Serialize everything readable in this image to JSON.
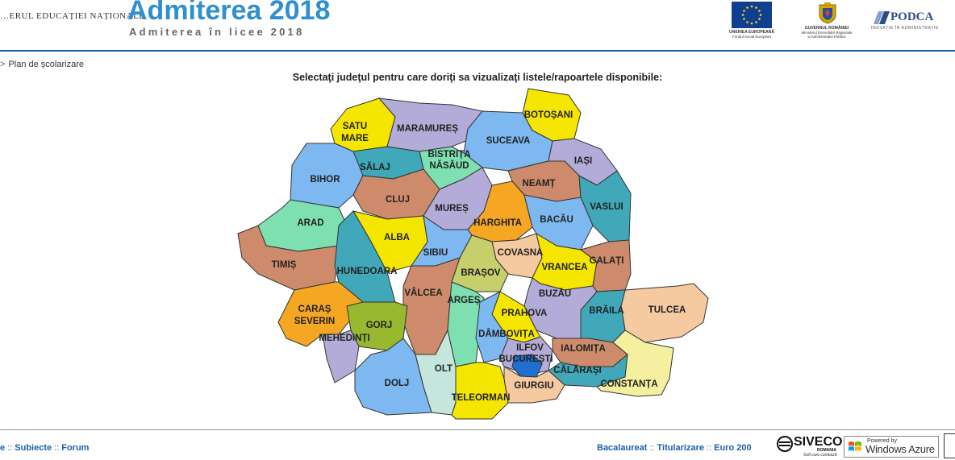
{
  "header": {
    "ministry": "…ERUL EDUCAȚIEI NAȚIONALE",
    "title": "Admiterea 2018",
    "subtitle": "Admiterea în licee 2018",
    "logos": {
      "eu_line1": "UNIUNEA EUROPEANĂ",
      "eu_line2": "Fondul Social European",
      "gov_line1": "GUVERNUL ROMÂNIEI",
      "gov_line2": "Ministerul Dezvoltării Regionale",
      "gov_line3": "și Administrației Publice",
      "podca_name": "PODCA",
      "podca_tag": "INOVAȚIE ÎN ADMINISTRAȚIE"
    },
    "colors": {
      "title": "#2f8fd0",
      "rule": "#1d5fa8"
    }
  },
  "breadcrumb": {
    "item": "Plan de școlarizare"
  },
  "instructions": "Selectaţi judeţul pentru care doriţi sa vizualizaţi listele/rapoartele disponibile:",
  "map": {
    "counties": [
      {
        "id": "satu-mare",
        "label": "SATU MARE",
        "color": "#f5e600"
      },
      {
        "id": "maramures",
        "label": "MARAMUREȘ",
        "color": "#b3acd8"
      },
      {
        "id": "botosani",
        "label": "BOTOȘANI",
        "color": "#f5e600"
      },
      {
        "id": "suceava",
        "label": "SUCEAVA",
        "color": "#7db8f0"
      },
      {
        "id": "bistrita-nasaud",
        "label": "BISTRIȚA NĂSĂUD",
        "color": "#7ee0b0"
      },
      {
        "id": "salaj",
        "label": "SĂLAJ",
        "color": "#40a8b8"
      },
      {
        "id": "bihor",
        "label": "BIHOR",
        "color": "#7db8f0"
      },
      {
        "id": "iasi",
        "label": "IAȘI",
        "color": "#b3acd8"
      },
      {
        "id": "neamt",
        "label": "NEAMȚ",
        "color": "#cd8b6b"
      },
      {
        "id": "cluj",
        "label": "CLUJ",
        "color": "#cd8b6b"
      },
      {
        "id": "mures",
        "label": "MUREȘ",
        "color": "#b3acd8"
      },
      {
        "id": "vaslui",
        "label": "VASLUI",
        "color": "#40a8b8"
      },
      {
        "id": "harghita",
        "label": "HARGHITA",
        "color": "#f5a623"
      },
      {
        "id": "bacau",
        "label": "BACĂU",
        "color": "#7db8f0"
      },
      {
        "id": "arad",
        "label": "ARAD",
        "color": "#7ee0b0"
      },
      {
        "id": "alba",
        "label": "ALBA",
        "color": "#f5e600"
      },
      {
        "id": "sibiu",
        "label": "SIBIU",
        "color": "#7db8f0"
      },
      {
        "id": "covasna",
        "label": "COVASNA",
        "color": "#f5caa0"
      },
      {
        "id": "vrancea",
        "label": "VRANCEA",
        "color": "#f5e600"
      },
      {
        "id": "galati",
        "label": "GALAȚI",
        "color": "#cd8b6b"
      },
      {
        "id": "timis",
        "label": "TIMIȘ",
        "color": "#cd8b6b"
      },
      {
        "id": "hunedoara",
        "label": "HUNEDOARA",
        "color": "#40a8b8"
      },
      {
        "id": "brasov",
        "label": "BRAȘOV",
        "color": "#c5cf6b"
      },
      {
        "id": "valcea",
        "label": "VÂLCEA",
        "color": "#cd8b6b"
      },
      {
        "id": "buzau",
        "label": "BUZĂU",
        "color": "#b3acd8"
      },
      {
        "id": "tulcea",
        "label": "TULCEA",
        "color": "#f5caa0"
      },
      {
        "id": "caras-severin",
        "label": "CARAȘ SEVERIN",
        "color": "#f5a623"
      },
      {
        "id": "arges",
        "label": "ARGEȘ",
        "color": "#7ee0b0"
      },
      {
        "id": "prahova",
        "label": "PRAHOVA",
        "color": "#f5e600"
      },
      {
        "id": "braila",
        "label": "BRĂILA",
        "color": "#40a8b8"
      },
      {
        "id": "gorj",
        "label": "GORJ",
        "color": "#98b830"
      },
      {
        "id": "mehedinti",
        "label": "MEHEDINȚI",
        "color": "#b3acd8"
      },
      {
        "id": "dambovita",
        "label": "DÂMBOVIȚA",
        "color": "#7db8f0"
      },
      {
        "id": "ilfov",
        "label": "ILFOV",
        "color": "#b3acd8"
      },
      {
        "id": "bucuresti",
        "label": "BUCUREȘTI",
        "color": "#1e6fd0"
      },
      {
        "id": "ialomita",
        "label": "IALOMIȚA",
        "color": "#cd8b6b"
      },
      {
        "id": "olt",
        "label": "OLT",
        "color": "#c4e6dc"
      },
      {
        "id": "calarasi",
        "label": "CĂLĂRAȘI",
        "color": "#40a8b8"
      },
      {
        "id": "dolj",
        "label": "DOLJ",
        "color": "#7db8f0"
      },
      {
        "id": "teleorman",
        "label": "TELEORMAN",
        "color": "#f5e600"
      },
      {
        "id": "giurgiu",
        "label": "GIURGIU",
        "color": "#f5caa0"
      },
      {
        "id": "constanta",
        "label": "CONSTANȚA",
        "color": "#f5f0a0"
      }
    ]
  },
  "footer": {
    "left_links": [
      "e",
      "Subiecte",
      "Forum"
    ],
    "right_links": [
      "Bacalaureat",
      "Titularizare",
      "Euro 200"
    ],
    "separator": "::",
    "link_color": "#1d5fa8",
    "siveco_name": "SIVECO",
    "siveco_country": "ROMANIA",
    "siveco_tag": "Soft care contează",
    "azure_small": "Powered by",
    "azure_big": "Windows Azure"
  }
}
